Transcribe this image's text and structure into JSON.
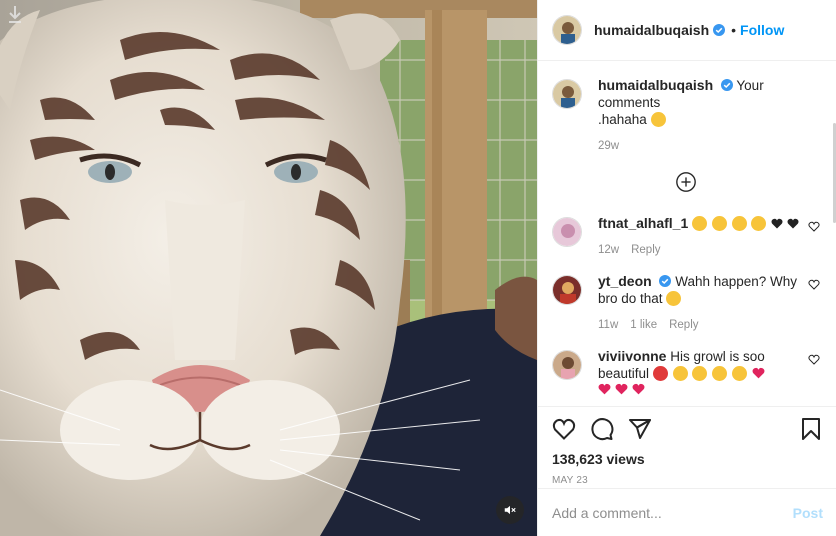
{
  "media": {
    "mute_icon": "speaker-muted-icon",
    "download_icon": "download-arrow-icon"
  },
  "header": {
    "username": "humaidalbuqaish",
    "separator": "•",
    "follow_label": "Follow",
    "verified_icon": "verified-badge-icon"
  },
  "caption": {
    "username": "humaidalbuqaish",
    "text": "Your comments",
    "text2": ".hahaha",
    "time": "29w"
  },
  "load_more_icon": "plus-circle-icon",
  "comments": [
    {
      "username": "ftnat_alhafl_1",
      "text": "",
      "time": "12w",
      "likes": "",
      "reply": "Reply"
    },
    {
      "username": "yt_deon",
      "text": "Wahh happen? Why bro do that",
      "time": "11w",
      "likes": "1 like",
      "reply": "Reply"
    },
    {
      "username": "viviivonne",
      "text": "His growl is soo beautiful",
      "time": "",
      "likes": "",
      "reply": ""
    }
  ],
  "actions": {
    "views": "138,623 views",
    "date": "MAY 23"
  },
  "add_comment": {
    "placeholder": "Add a comment...",
    "post_label": "Post"
  },
  "colors": {
    "accent": "#0095f6",
    "post_disabled": "#b2dffc",
    "muted_text": "#8e8e8e"
  }
}
